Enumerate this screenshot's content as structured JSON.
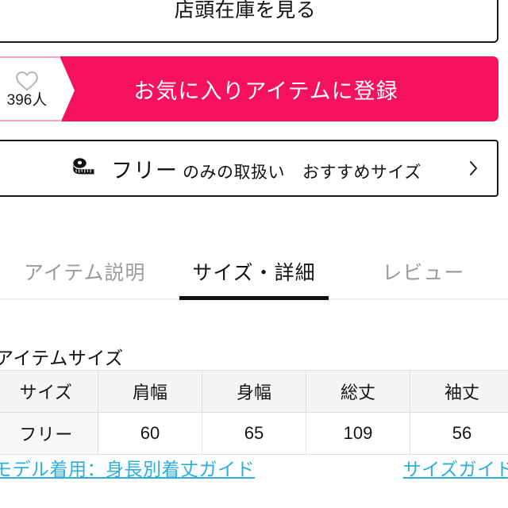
{
  "store_stock": {
    "label": "店頭在庫を見る"
  },
  "favorite": {
    "label": "お気に入りアイテムに登録",
    "count": "396人",
    "heart_icon": "heart-outline-icon",
    "bar_color": "#f5125c",
    "panel_border_color": "#f5a6c4"
  },
  "size_selector": {
    "tape_icon": "tape-measure-icon",
    "primary": "フリー",
    "sub": "のみの取扱い",
    "recommend": "おすすめサイズ",
    "chevron_icon": "chevron-right-icon"
  },
  "tabs": [
    {
      "label": "アイテム説明",
      "active": false
    },
    {
      "label": "サイズ・詳細",
      "active": true
    },
    {
      "label": "レビュー",
      "active": false
    }
  ],
  "item_size": {
    "title": "アイテムサイズ",
    "headers": [
      "サイズ",
      "肩幅",
      "身幅",
      "総丈",
      "袖丈"
    ],
    "rows": [
      [
        "フリー",
        "60",
        "65",
        "109",
        "56"
      ]
    ]
  },
  "guide_links": {
    "model": "モデル着用：身長別着丈ガイド",
    "size": "サイズガイド",
    "color": "#2eaedb"
  }
}
